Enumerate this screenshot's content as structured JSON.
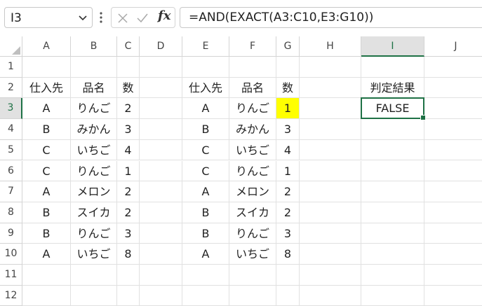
{
  "namebox": {
    "value": "I3"
  },
  "formula_bar": {
    "fx_label": "fx",
    "formula": "=AND(EXACT(A3:C10,E3:G10))"
  },
  "columns": [
    "A",
    "B",
    "C",
    "D",
    "E",
    "F",
    "G",
    "H",
    "I",
    "J"
  ],
  "rows": [
    "1",
    "2",
    "3",
    "4",
    "5",
    "6",
    "7",
    "8",
    "9",
    "10",
    "11",
    "12"
  ],
  "selected": {
    "column": "I",
    "row": "3"
  },
  "cells": {
    "A2": "仕入先",
    "B2": "品名",
    "C2": "数",
    "A3": "A",
    "B3": "りんご",
    "C3": "2",
    "A4": "B",
    "B4": "みかん",
    "C4": "3",
    "A5": "C",
    "B5": "いちご",
    "C5": "4",
    "A6": "C",
    "B6": "りんご",
    "C6": "1",
    "A7": "A",
    "B7": "メロン",
    "C7": "2",
    "A8": "B",
    "B8": "スイカ",
    "C8": "2",
    "A9": "B",
    "B9": "りんご",
    "C9": "3",
    "A10": "A",
    "B10": "いちご",
    "C10": "8",
    "E2": "仕入先",
    "F2": "品名",
    "G2": "数",
    "E3": "A",
    "F3": "りんご",
    "G3": "1",
    "E4": "B",
    "F4": "みかん",
    "G4": "3",
    "E5": "C",
    "F5": "いちご",
    "G5": "4",
    "E6": "C",
    "F6": "りんご",
    "G6": "1",
    "E7": "A",
    "F7": "メロン",
    "G7": "2",
    "E8": "B",
    "F8": "スイカ",
    "G8": "2",
    "E9": "B",
    "F9": "りんご",
    "G9": "3",
    "E10": "A",
    "F10": "いちご",
    "G10": "8",
    "I2": "判定結果",
    "I3": "FALSE"
  },
  "highlighted_cells": {
    "G3": "#ffff00"
  },
  "colors": {
    "selection": "#1e7145",
    "gridline": "#e1e1e1",
    "header_selected": "#e1e1e1"
  }
}
